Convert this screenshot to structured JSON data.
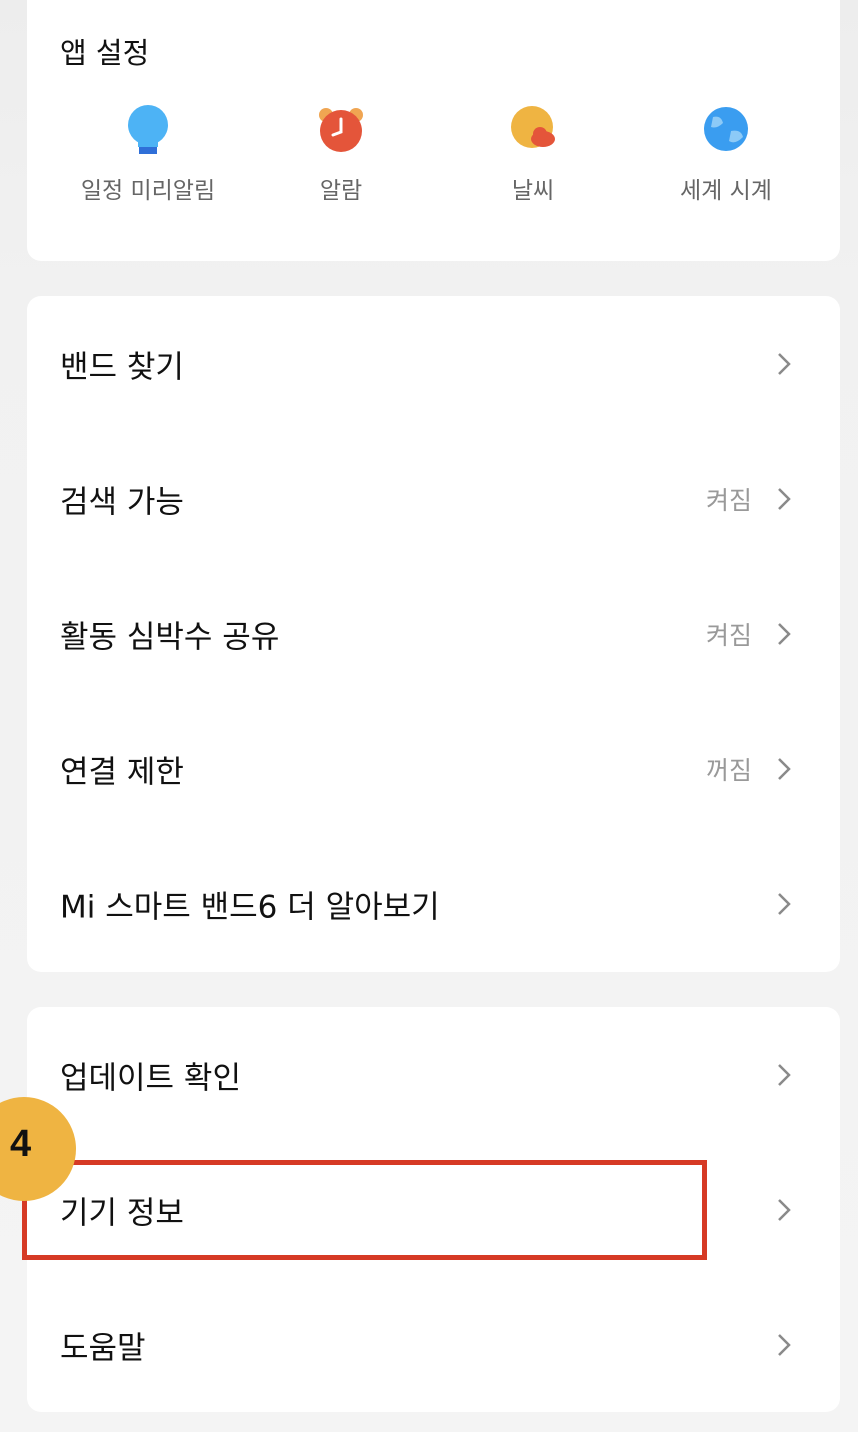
{
  "app_settings": {
    "title": "앱 설정",
    "items": [
      {
        "label": "일정 미리알림",
        "icon": "lightbulb-icon",
        "color": "#4db3f5"
      },
      {
        "label": "알람",
        "icon": "alarm-clock-icon",
        "color": "#e4553a"
      },
      {
        "label": "날씨",
        "icon": "weather-icon",
        "color": "#efb442"
      },
      {
        "label": "세계 시계",
        "icon": "globe-icon",
        "color": "#3a9df0"
      }
    ]
  },
  "main_list": [
    {
      "label": "밴드 찾기",
      "value": ""
    },
    {
      "label": "검색 가능",
      "value": "켜짐"
    },
    {
      "label": "활동 심박수 공유",
      "value": "켜짐"
    },
    {
      "label": "연결 제한",
      "value": "꺼짐"
    },
    {
      "label": "Mi 스마트 밴드6 더 알아보기",
      "value": ""
    }
  ],
  "system_list": [
    {
      "label": "업데이트 확인"
    },
    {
      "label": "기기 정보"
    },
    {
      "label": "도움말"
    }
  ],
  "annotation": {
    "step_number": "4",
    "highlight_color": "#d63a25",
    "badge_color": "#efb442"
  }
}
